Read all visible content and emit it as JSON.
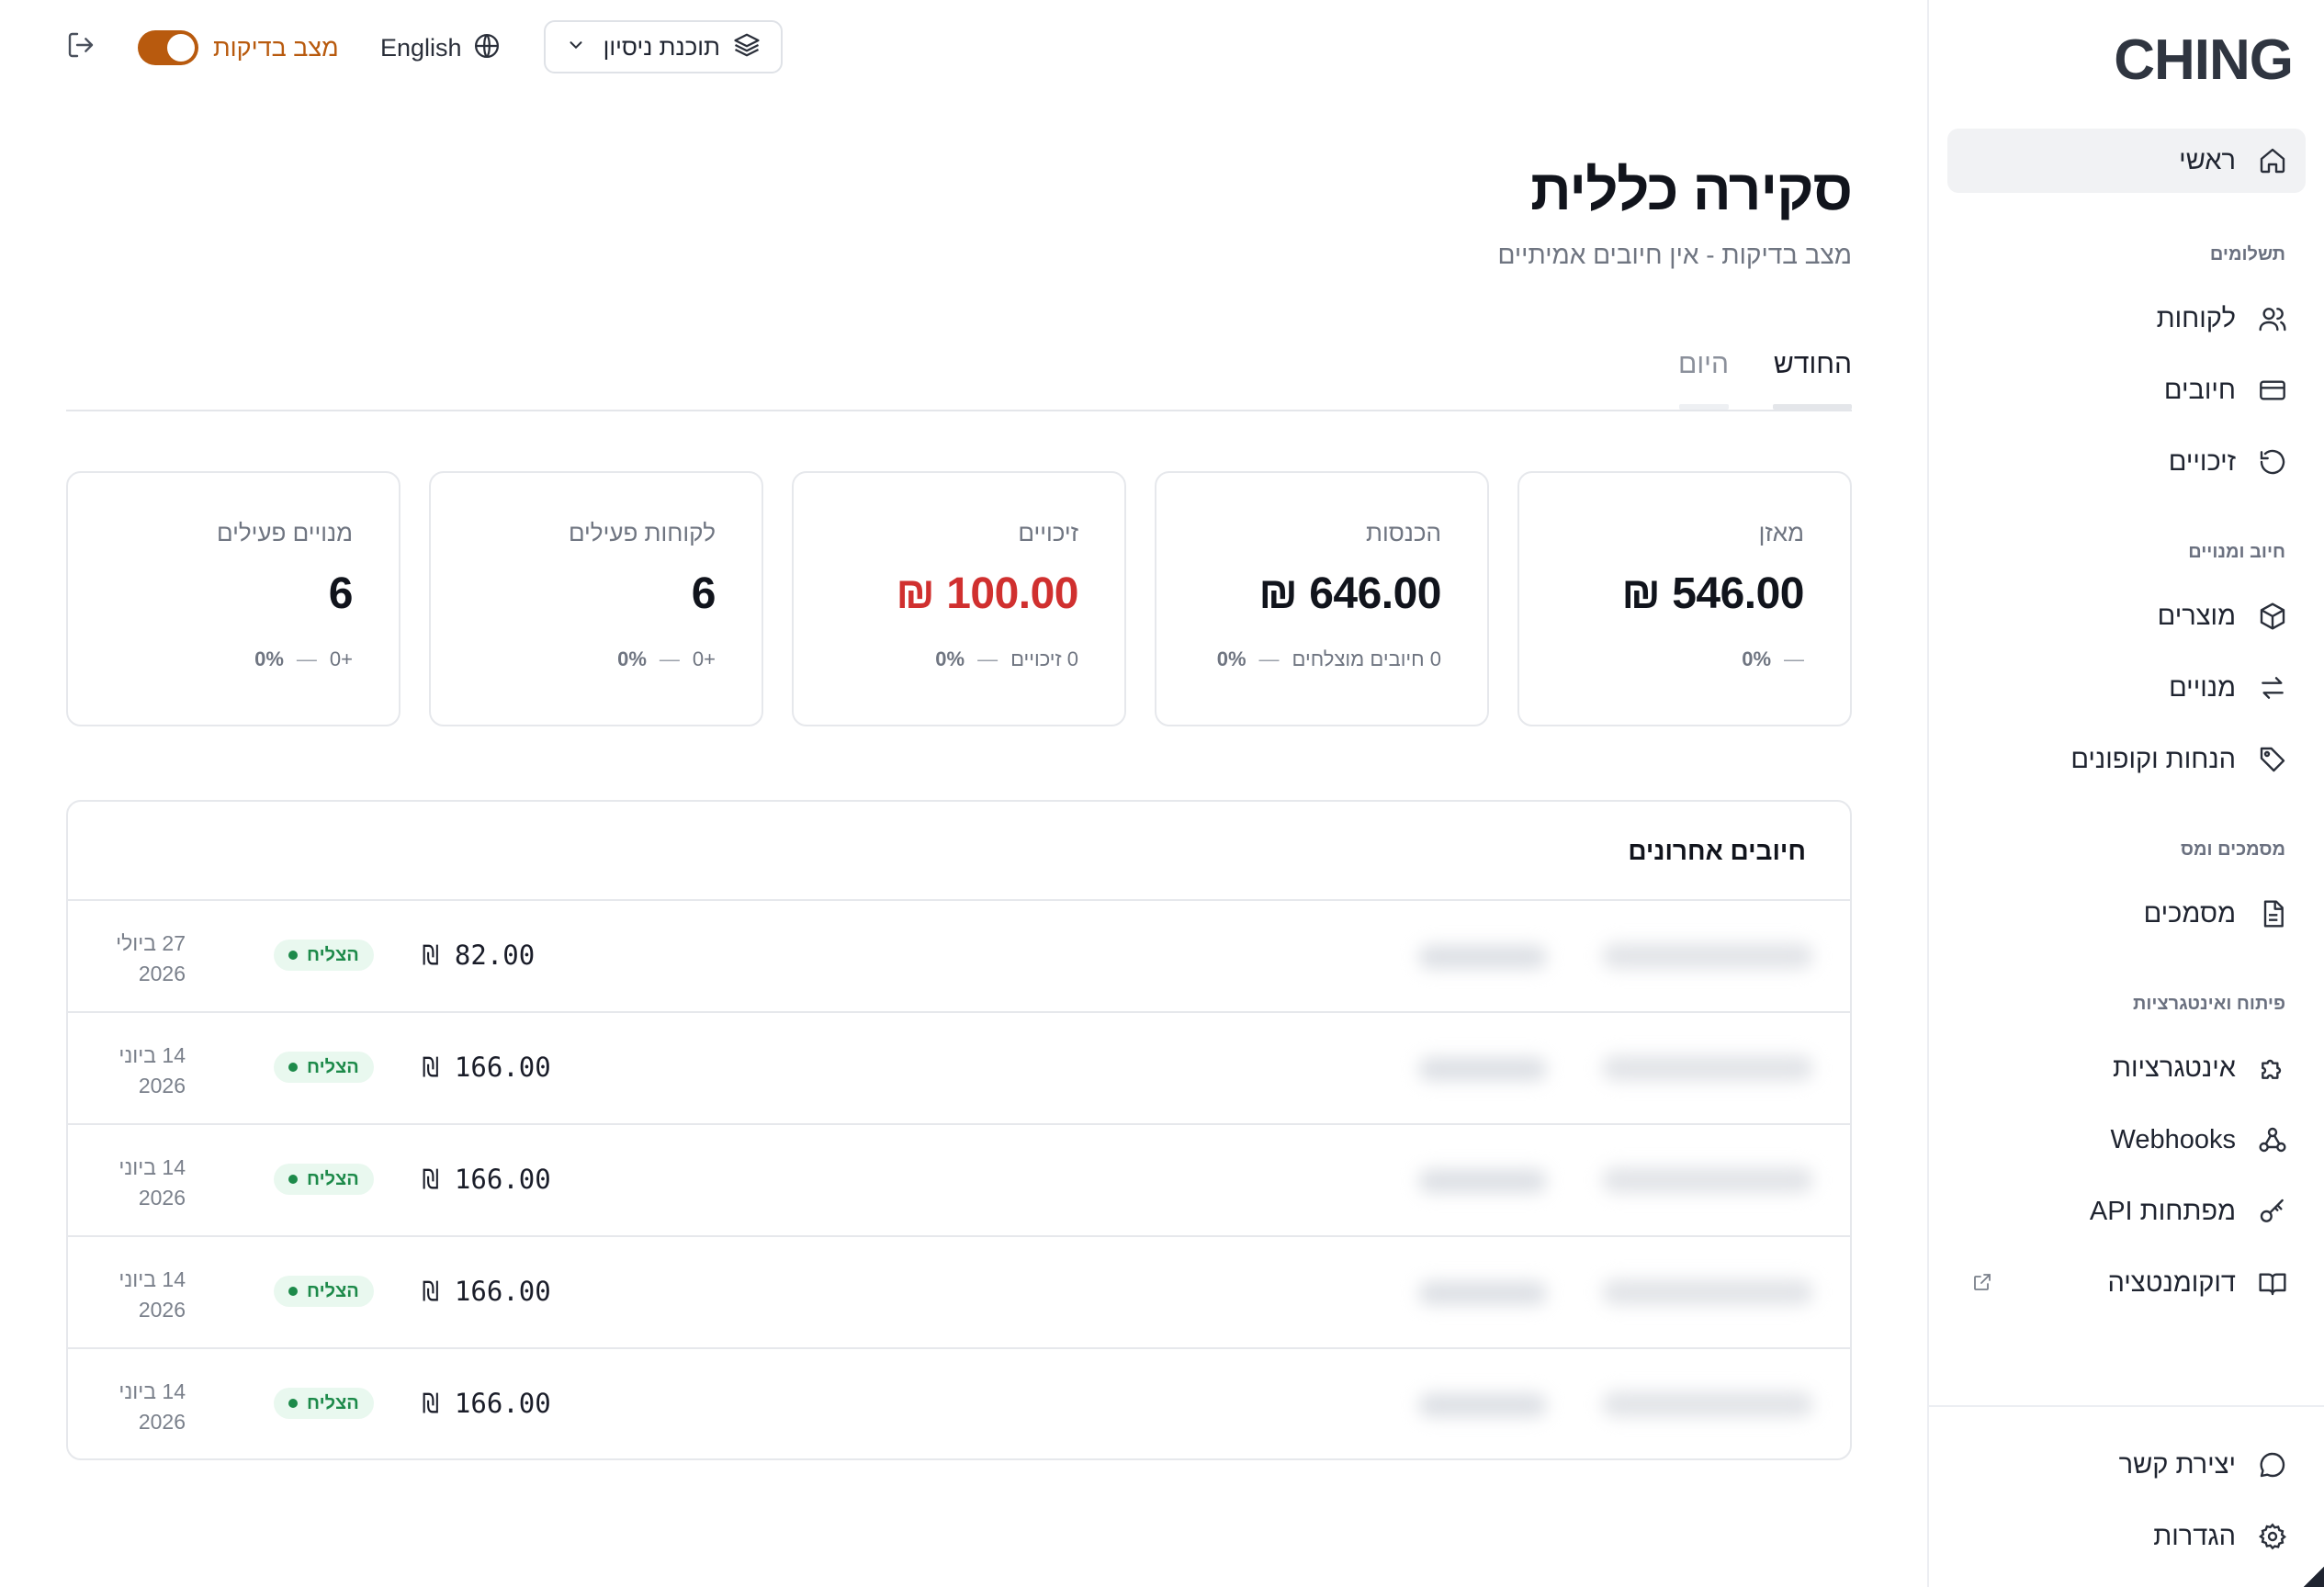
{
  "brand": {
    "logo": "CHING"
  },
  "topbar": {
    "plan_label": "תוכנת ניסיון",
    "language_label": "English",
    "test_mode_label": "מצב בדיקות",
    "test_mode_on": true
  },
  "sidebar": {
    "items": [
      {
        "label": "ראשי",
        "icon": "home-icon",
        "active": true
      },
      {
        "section": "תשלומים"
      },
      {
        "label": "לקוחות",
        "icon": "users-icon"
      },
      {
        "label": "חיובים",
        "icon": "credit-card-icon"
      },
      {
        "label": "זיכויים",
        "icon": "refund-icon"
      },
      {
        "section": "חיוב ומנויים"
      },
      {
        "label": "מוצרים",
        "icon": "box-icon"
      },
      {
        "label": "מנויים",
        "icon": "repeat-icon"
      },
      {
        "label": "הנחות וקופונים",
        "icon": "tag-icon"
      },
      {
        "section": "מסמכים ומס"
      },
      {
        "label": "מסמכים",
        "icon": "document-icon"
      },
      {
        "section": "פיתוח ואינטגרציות"
      },
      {
        "label": "אינטגרציות",
        "icon": "puzzle-icon"
      },
      {
        "label": "Webhooks",
        "icon": "webhook-icon"
      },
      {
        "label": "מפתחות API",
        "icon": "key-icon"
      },
      {
        "label": "דוקומנטציה",
        "icon": "book-icon",
        "external": true
      }
    ],
    "footer": [
      {
        "label": "יצירת קשר",
        "icon": "chat-icon"
      },
      {
        "label": "הגדרות",
        "icon": "gear-icon"
      }
    ]
  },
  "header": {
    "title": "סקירה כללית",
    "subtitle": "מצב בדיקות - אין חיובים אמיתיים"
  },
  "tabs": [
    {
      "label": "החודש",
      "active": true
    },
    {
      "label": "היום",
      "active": false
    }
  ],
  "cards": [
    {
      "label": "מאזן",
      "value": "546.00 ₪",
      "foot_text": "",
      "pct": "0%",
      "negative": false
    },
    {
      "label": "הכנסות",
      "value": "646.00 ₪",
      "foot_text": "0 חיובים מוצלחים",
      "pct": "0%",
      "negative": false
    },
    {
      "label": "זיכויים",
      "value": "100.00 ₪",
      "foot_text": "0 זיכויים",
      "pct": "0%",
      "negative": true
    },
    {
      "label": "לקוחות פעילים",
      "value": "6",
      "foot_text": "+0",
      "pct": "0%",
      "negative": false
    },
    {
      "label": "מנויים פעילים",
      "value": "6",
      "foot_text": "+0",
      "pct": "0%",
      "negative": false
    }
  ],
  "recent": {
    "title": "חיובים אחרונים",
    "rows": [
      {
        "amount": "₪ 82.00",
        "status": "הצליח",
        "date_line1": "27 ביולי",
        "date_line2": "2026"
      },
      {
        "amount": "₪ 166.00",
        "status": "הצליח",
        "date_line1": "14 ביוני",
        "date_line2": "2026"
      },
      {
        "amount": "₪ 166.00",
        "status": "הצליח",
        "date_line1": "14 ביוני",
        "date_line2": "2026"
      },
      {
        "amount": "₪ 166.00",
        "status": "הצליח",
        "date_line1": "14 ביוני",
        "date_line2": "2026"
      },
      {
        "amount": "₪ 166.00",
        "status": "הצליח",
        "date_line1": "14 ביוני",
        "date_line2": "2026"
      }
    ]
  },
  "colors": {
    "accent": "#b85a0e",
    "negative": "#d0302f",
    "success": "#1d8a4a",
    "success_bg": "#e9f8ef"
  }
}
